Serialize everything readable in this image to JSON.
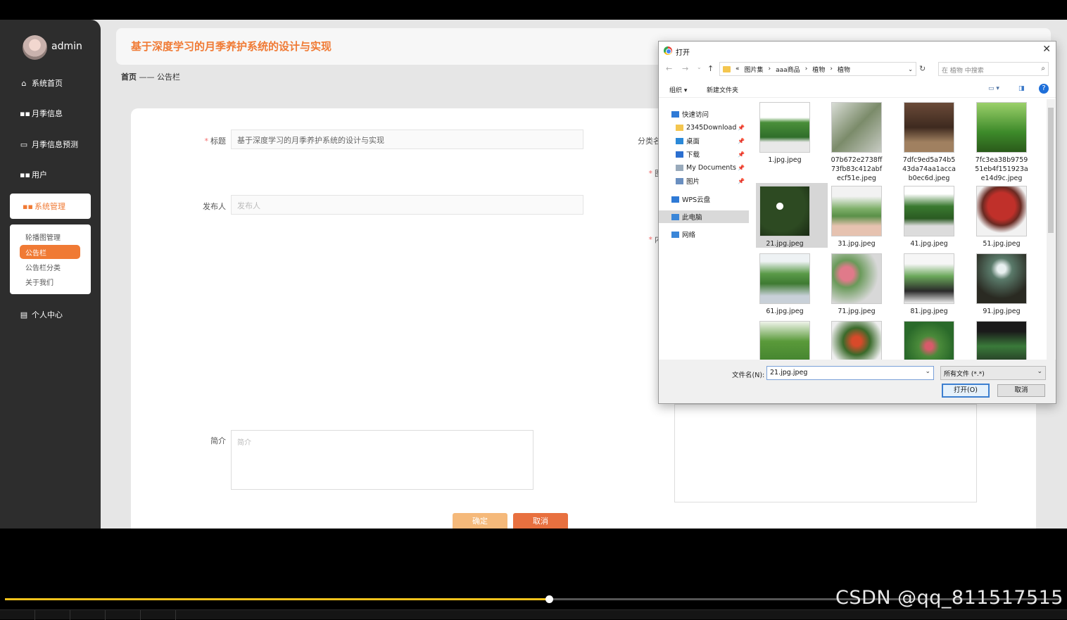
{
  "sidebar": {
    "user": "admin",
    "items": [
      {
        "icon": "home-icon",
        "glyph": "⌂",
        "label": "系统首页"
      },
      {
        "icon": "grid-icon",
        "glyph": "▪▪",
        "label": "月季信息"
      },
      {
        "icon": "briefcase-icon",
        "glyph": "▭",
        "label": "月季信息预测"
      },
      {
        "icon": "grid-icon",
        "glyph": "▪▪",
        "label": "用户"
      },
      {
        "icon": "grid-icon",
        "glyph": "▪▪",
        "label": "系统管理"
      },
      {
        "icon": "calendar-icon",
        "glyph": "▤",
        "label": "个人中心"
      }
    ],
    "submenu": [
      "轮播图管理",
      "公告栏",
      "公告栏分类",
      "关于我们"
    ]
  },
  "header": {
    "title": "基于深度学习的月季养护系统的设计与实现"
  },
  "breadcrumb": {
    "home": "首页",
    "sep": "——",
    "current": "公告栏"
  },
  "form": {
    "title_label": "标题",
    "title_value": "基于深度学习的月季养护系统的设计与实现",
    "publisher_label": "发布人",
    "publisher_placeholder": "发布人",
    "intro_label": "简介",
    "intro_placeholder": "简介",
    "category_label": "分类名",
    "image_label": "图",
    "content_label": "内",
    "ok": "确定",
    "cancel": "取消"
  },
  "dialog": {
    "title": "打开",
    "path": [
      "«",
      "图片集",
      "›",
      "aaa商品",
      "›",
      "植物",
      "›",
      "植物"
    ],
    "search_placeholder": "在 植物 中搜索",
    "organize": "组织 ▾",
    "new_folder": "新建文件夹",
    "tree": [
      {
        "label": "快速访问",
        "icon": "star-icon",
        "color": "#2f7ad6"
      },
      {
        "label": "2345Download",
        "icon": "folder-icon",
        "color": "#f4c64f",
        "pin": true
      },
      {
        "label": "桌面",
        "icon": "desktop-icon",
        "color": "#2b89d8",
        "pin": true
      },
      {
        "label": "下载",
        "icon": "download-icon",
        "color": "#2b6fd0",
        "pin": true
      },
      {
        "label": "My Documents",
        "icon": "document-icon",
        "color": "#9ab",
        "pin": true
      },
      {
        "label": "图片",
        "icon": "picture-icon",
        "color": "#6a8fc0",
        "pin": true
      },
      {
        "label": "WPS云盘",
        "icon": "cloud-icon",
        "color": "#2f7ad6"
      },
      {
        "label": "此电脑",
        "icon": "computer-icon",
        "color": "#3a86d8"
      },
      {
        "label": "网络",
        "icon": "network-icon",
        "color": "#3a86d8"
      }
    ],
    "files": [
      {
        "name": "1.jpg.jpeg",
        "bg": "linear-gradient(#ffffff 30%, #4a8f3a 40%, #2f6e2a 70%, #e8e8e8 80%)"
      },
      {
        "name": "07b672e2738ff73fb83c412abfecf51e.jpeg",
        "bg": "linear-gradient(135deg, #d9ddd6, #7b8b6a 50%, #c7cbc3)"
      },
      {
        "name": "7dfc9ed5a74b543da74aa1accab0ec6d.jpeg",
        "bg": "linear-gradient(#6a4a38, #3e2a1f 50%, #a08060 80%)"
      },
      {
        "name": "7fc3ea38b975951eb4f151923ae14d9c.jpeg",
        "bg": "linear-gradient(#9bd06a, #3d8a2a 60%, #2a5a1a)"
      },
      {
        "name": "21.jpg.jpeg",
        "bg": "radial-gradient(circle at 40% 40%, #ffffff 0 8%, #2d4a22 9% 60%, #1a2a14)"
      },
      {
        "name": "31.jpg.jpeg",
        "bg": "linear-gradient(#f2f2f2 20%, #7fb06a 45%, #5a9048 60%, #e6c2b0 80%)"
      },
      {
        "name": "41.jpg.jpeg",
        "bg": "linear-gradient(#ffffff 15%, #3a7a30 40%, #2a5a22 65%, #dcdcdc 80%)"
      },
      {
        "name": "51.jpg.jpeg",
        "bg": "radial-gradient(circle at 50% 40%, #c0302a 0 35%, #6a2a22 50%, #f2f2f2 70%)"
      },
      {
        "name": "61.jpg.jpeg",
        "bg": "linear-gradient(#eef2f4 15%, #5a9a48 40%, #3e7a32 60%, #c8d0d8 85%)"
      },
      {
        "name": "71.jpg.jpeg",
        "bg": "radial-gradient(circle at 30% 40%, #e07a8a 0 15%, #6a9a5a 30%, #d8d8d8 70%)"
      },
      {
        "name": "81.jpg.jpeg",
        "bg": "linear-gradient(#f6f6f6 20%, #6aa85a 45%, #2a2a2a 75%, #eeeeee)"
      },
      {
        "name": "91.jpg.jpeg",
        "bg": "radial-gradient(circle at 50% 30%, #e8f0f0 0 10%, #5a7a6a 25%, #2a2a22 70%)"
      },
      {
        "name": "",
        "bg": "linear-gradient(#f0f4ea, #5a9a3a 40%, #3a7a2a)"
      },
      {
        "name": "",
        "bg": "radial-gradient(circle at 50% 40%, #d84a2a 0 12%, #3a6a2a 35%, #eeeeee 70%)"
      },
      {
        "name": "",
        "bg": "radial-gradient(circle at 50% 50%, #d85a6a 0 10%, #4a8a3a 30%, #2a6a2a 70%)"
      },
      {
        "name": "",
        "bg": "linear-gradient(#1a1a1a 20%, #3a7a3a 50%, #1a1a1a)"
      }
    ],
    "filename_label": "文件名(N):",
    "filename_value": "21.jpg.jpeg",
    "filetype": "所有文件 (*.*)",
    "open": "打开(O)",
    "cancel": "取消"
  },
  "video": {
    "progress": 0.515
  },
  "watermark": "CSDN @qq_811517515"
}
